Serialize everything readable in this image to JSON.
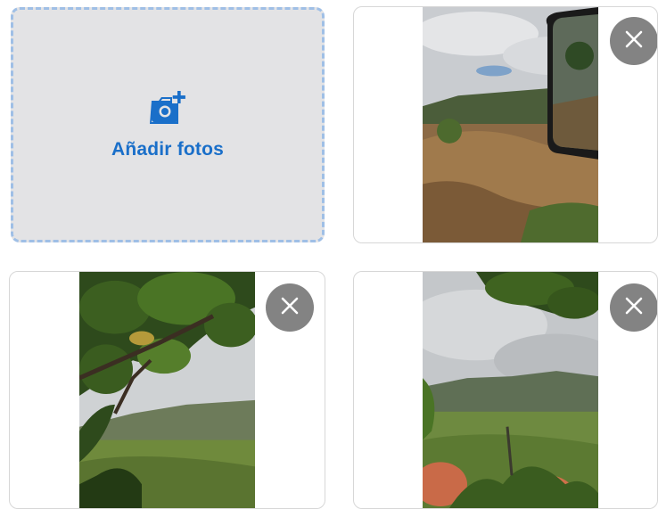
{
  "add_photos": {
    "label": "Añadir fotos",
    "icon": "add-photo-icon",
    "accent_color": "#1a6fc9"
  },
  "photos": [
    {
      "id_label": "photo-1",
      "remove_icon": "close-icon"
    },
    {
      "id_label": "photo-2",
      "remove_icon": "close-icon"
    },
    {
      "id_label": "photo-3",
      "remove_icon": "close-icon"
    }
  ]
}
